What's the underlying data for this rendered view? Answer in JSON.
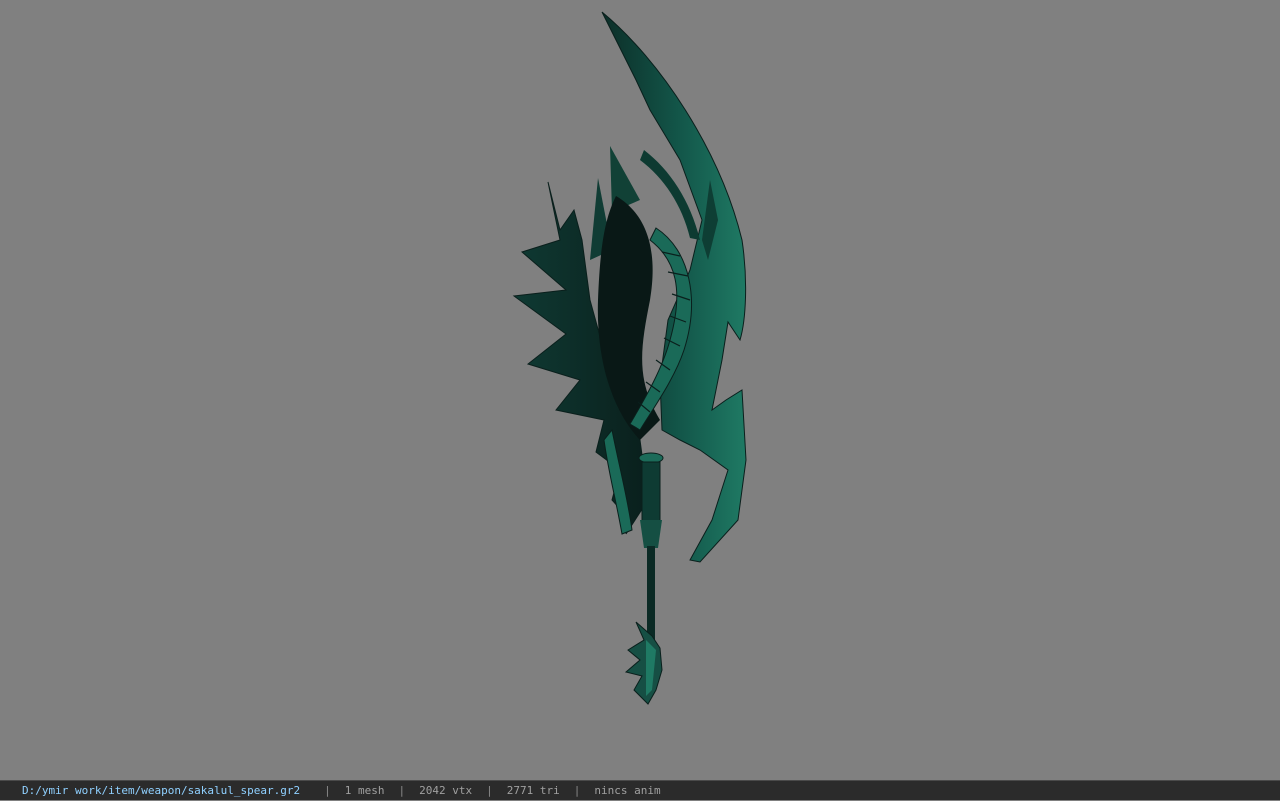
{
  "colors": {
    "viewport_bg": "#808080",
    "status_bg": "#2b2b2b",
    "path_text": "#8fd0ff",
    "info_text": "#a0a0a0",
    "blade_main": "#13574a",
    "blade_dark": "#0c2e28",
    "blade_highlight": "#1f7a64",
    "blade_shadow": "#0a1f1c"
  },
  "status": {
    "file_path": "D:/ymir work/item/weapon/sakalul_spear.gr2",
    "separator": "|",
    "mesh_count": "1 mesh",
    "vertex_count": "2042 vtx",
    "triangle_count": "2771 tri",
    "animation": "nincs anim"
  },
  "viewport": {
    "model_icon": "spear-model"
  }
}
